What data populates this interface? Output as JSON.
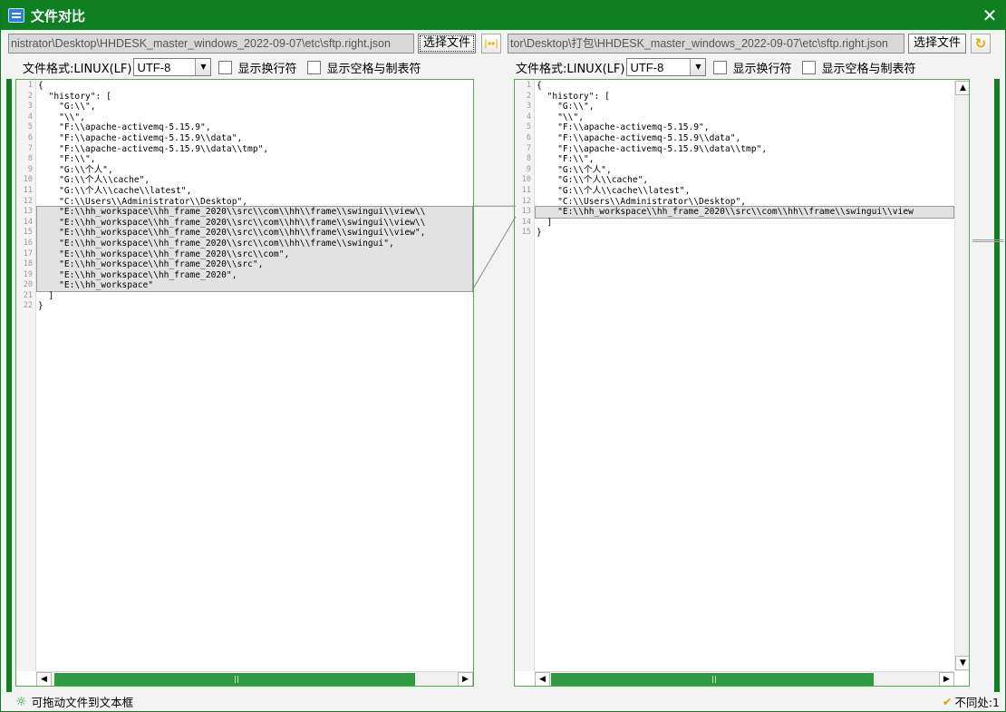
{
  "window": {
    "title": "文件对比",
    "close_label": "✕"
  },
  "left": {
    "path": "nistrator\\Desktop\\HHDESK_master_windows_2022-09-07\\etc\\sftp.right.json",
    "choose_label": "选择文件",
    "format_label": "文件格式:LINUX(LF)",
    "encoding": "UTF-8",
    "show_newline_label": "显示换行符",
    "show_space_label": "显示空格与制表符",
    "lines": [
      "{",
      "  \"history\": [",
      "    \"G:\\\\\",",
      "    \"\\\\\",",
      "    \"F:\\\\apache-activemq-5.15.9\",",
      "    \"F:\\\\apache-activemq-5.15.9\\\\data\",",
      "    \"F:\\\\apache-activemq-5.15.9\\\\data\\\\tmp\",",
      "    \"F:\\\\\",",
      "    \"G:\\\\个人\",",
      "    \"G:\\\\个人\\\\cache\",",
      "    \"G:\\\\个人\\\\cache\\\\latest\",",
      "    \"C:\\\\Users\\\\Administrator\\\\Desktop\",",
      "    \"E:\\\\hh_workspace\\\\hh_frame_2020\\\\src\\\\com\\\\hh\\\\frame\\\\swingui\\\\view\\\\",
      "    \"E:\\\\hh_workspace\\\\hh_frame_2020\\\\src\\\\com\\\\hh\\\\frame\\\\swingui\\\\view\\\\",
      "    \"E:\\\\hh_workspace\\\\hh_frame_2020\\\\src\\\\com\\\\hh\\\\frame\\\\swingui\\\\view\",",
      "    \"E:\\\\hh_workspace\\\\hh_frame_2020\\\\src\\\\com\\\\hh\\\\frame\\\\swingui\",",
      "    \"E:\\\\hh_workspace\\\\hh_frame_2020\\\\src\\\\com\",",
      "    \"E:\\\\hh_workspace\\\\hh_frame_2020\\\\src\",",
      "    \"E:\\\\hh_workspace\\\\hh_frame_2020\",",
      "    \"E:\\\\hh_workspace\"",
      "  ]",
      "}"
    ],
    "diff_lines": [
      13,
      20
    ]
  },
  "right": {
    "path": "tor\\Desktop\\打包\\HHDESK_master_windows_2022-09-07\\etc\\sftp.right.json",
    "choose_label": "选择文件",
    "format_label": "文件格式:LINUX(LF)",
    "encoding": "UTF-8",
    "show_newline_label": "显示换行符",
    "show_space_label": "显示空格与制表符",
    "lines": [
      "{",
      "  \"history\": [",
      "    \"G:\\\\\",",
      "    \"\\\\\",",
      "    \"F:\\\\apache-activemq-5.15.9\",",
      "    \"F:\\\\apache-activemq-5.15.9\\\\data\",",
      "    \"F:\\\\apache-activemq-5.15.9\\\\data\\\\tmp\",",
      "    \"F:\\\\\",",
      "    \"G:\\\\个人\",",
      "    \"G:\\\\个人\\\\cache\",",
      "    \"G:\\\\个人\\\\cache\\\\latest\",",
      "    \"C:\\\\Users\\\\Administrator\\\\Desktop\",",
      "    \"E:\\\\hh_workspace\\\\hh_frame_2020\\\\src\\\\com\\\\hh\\\\frame\\\\swingui\\\\view",
      "  ]",
      "}"
    ],
    "diff_lines": [
      13,
      13
    ]
  },
  "toolbar": {
    "sync_label": "|↔|",
    "refresh_label": "↻"
  },
  "scroll": {
    "up": "▲",
    "down": "▼",
    "left": "◀",
    "right": "▶"
  },
  "status": {
    "hint": "可拖动文件到文本框",
    "diff_count": "不同处:1",
    "hint_icon": "☼",
    "check_icon": "✔"
  },
  "colors": {
    "accent": "#0f7f22",
    "diff_band": "#e2e2e2"
  }
}
